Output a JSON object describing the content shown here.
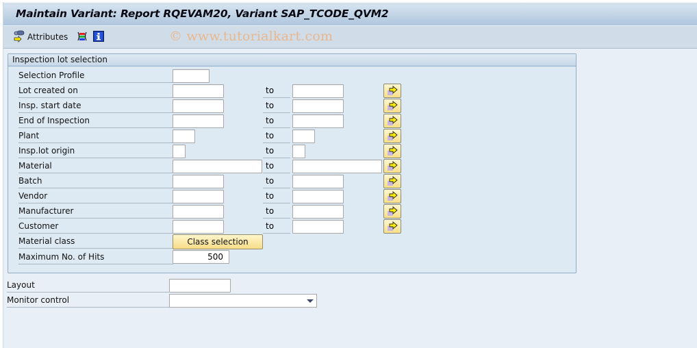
{
  "window": {
    "title": "Maintain Variant: Report RQEVAM20, Variant SAP_TCODE_QVM2"
  },
  "toolbar": {
    "attributes_label": "Attributes",
    "icons": [
      "attributes-icon",
      "layout-icon",
      "info-icon"
    ]
  },
  "watermark": "© www.tutorialkart.com",
  "selection_group": {
    "title": "Inspection lot selection",
    "to_label": "to",
    "rows": [
      {
        "label": "Selection Profile",
        "from": "",
        "to": null
      },
      {
        "label": "Lot created on",
        "from": "",
        "to": ""
      },
      {
        "label": "Insp. start date",
        "from": "",
        "to": ""
      },
      {
        "label": "End of Inspection",
        "from": "",
        "to": ""
      },
      {
        "label": "Plant",
        "from": "",
        "to": ""
      },
      {
        "label": "Insp.lot origin",
        "from": "",
        "to": ""
      },
      {
        "label": "Material",
        "from": "",
        "to": ""
      },
      {
        "label": "Batch",
        "from": "",
        "to": ""
      },
      {
        "label": "Vendor",
        "from": "",
        "to": ""
      },
      {
        "label": "Manufacturer",
        "from": "",
        "to": ""
      },
      {
        "label": "Customer",
        "from": "",
        "to": ""
      }
    ],
    "material_class": {
      "label": "Material class",
      "button_label": "Class selection"
    },
    "max_hits": {
      "label": "Maximum No. of Hits",
      "value": "500"
    }
  },
  "output_options": {
    "layout": {
      "label": "Layout",
      "value": ""
    },
    "monitor_control": {
      "label": "Monitor control",
      "selected": ""
    }
  },
  "colors": {
    "background": "#e9eff7",
    "group_background": "#dde9f3",
    "button_yellow": "#f7df86",
    "watermark": "#e9b78e"
  }
}
